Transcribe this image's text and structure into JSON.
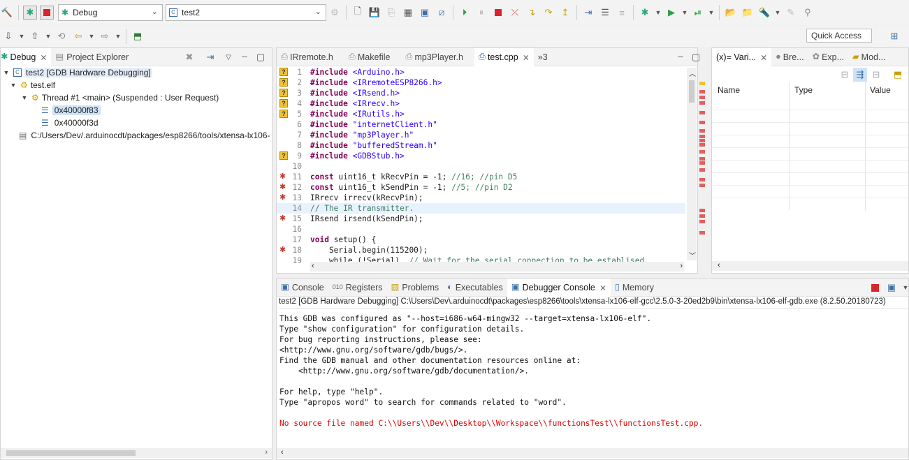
{
  "toolbar": {
    "launch_config": "Debug",
    "launch_target": "test2",
    "quick_access": "Quick Access"
  },
  "debug_view": {
    "tabs": [
      {
        "label": "Debug"
      },
      {
        "label": "Project Explorer"
      }
    ],
    "tree": [
      {
        "label": "test2 [GDB Hardware Debugging]"
      },
      {
        "label": "test.elf"
      },
      {
        "label": "Thread #1 <main> (Suspended : User Request)"
      },
      {
        "label": "0x40000f83"
      },
      {
        "label": "0x40000f3d"
      },
      {
        "label": "C:/Users/Dev/.arduinocdt/packages/esp8266/tools/xtensa-lx106-"
      }
    ]
  },
  "editor": {
    "tabs": [
      {
        "label": "IRremote.h"
      },
      {
        "label": "Makefile"
      },
      {
        "label": "mp3Player.h"
      },
      {
        "label": "test.cpp"
      },
      {
        "label": "»3"
      }
    ],
    "lines": [
      {
        "n": "1",
        "pre": "#include ",
        "arg": "<Arduino.h>",
        "marker": "q"
      },
      {
        "n": "2",
        "pre": "#include ",
        "arg": "<IRremoteESP8266.h>",
        "marker": "q"
      },
      {
        "n": "3",
        "pre": "#include ",
        "arg": "<IRsend.h>",
        "marker": "q"
      },
      {
        "n": "4",
        "pre": "#include ",
        "arg": "<IRrecv.h>",
        "marker": "q"
      },
      {
        "n": "5",
        "pre": "#include ",
        "arg": "<IRutils.h>",
        "marker": "q"
      },
      {
        "n": "6",
        "pre": "#include ",
        "arg": "\"internetClient.h\"",
        "marker": ""
      },
      {
        "n": "7",
        "pre": "#include ",
        "arg": "\"mp3Player.h\"",
        "marker": ""
      },
      {
        "n": "8",
        "pre": "#include ",
        "arg": "\"bufferedStream.h\"",
        "marker": ""
      },
      {
        "n": "9",
        "pre": "#include ",
        "arg": "<GDBStub.h>",
        "marker": "q"
      },
      {
        "n": "10",
        "code": "",
        "marker": ""
      },
      {
        "n": "11",
        "kw": "const",
        "code": " uint16_t kRecvPin = -1; ",
        "cmt": "//16; //pin D5",
        "marker": "bp"
      },
      {
        "n": "12",
        "kw": "const",
        "code": " uint16_t kSendPin = -1; ",
        "cmt": "//5; //pin D2",
        "marker": "bp"
      },
      {
        "n": "13",
        "code": "IRrecv irrecv(kRecvPin);",
        "marker": "bp"
      },
      {
        "n": "14",
        "cmt": "// The IR transmitter.",
        "marker": "",
        "current": true
      },
      {
        "n": "15",
        "code": "IRsend irsend(kSendPin);",
        "marker": "bp"
      },
      {
        "n": "16",
        "code": "",
        "marker": ""
      },
      {
        "n": "17",
        "kw": "void",
        "code": " setup() {",
        "marker": ""
      },
      {
        "n": "18",
        "code": "    Serial.begin(115200);",
        "marker": "bp"
      },
      {
        "n": "19",
        "code": "    while (!Serial)  ",
        "cmt": "// Wait for the serial connection to be establised.",
        "marker": ""
      }
    ]
  },
  "variables_view": {
    "tabs": [
      {
        "label": "(x)= Vari..."
      },
      {
        "label": "Bre..."
      },
      {
        "label": "Exp..."
      },
      {
        "label": "Mod..."
      }
    ],
    "columns": [
      "Name",
      "Type",
      "Value"
    ]
  },
  "console_view": {
    "tabs": [
      {
        "label": "Console"
      },
      {
        "label": "Registers"
      },
      {
        "label": "Problems"
      },
      {
        "label": "Executables"
      },
      {
        "label": "Debugger Console"
      },
      {
        "label": "Memory"
      }
    ],
    "header": "test2 [GDB Hardware Debugging] C:\\Users\\Dev\\.arduinocdt\\packages\\esp8266\\tools\\xtensa-lx106-elf-gcc\\2.5.0-3-20ed2b9\\bin\\xtensa-lx106-elf-gdb.exe (8.2.50.20180723)",
    "lines": [
      {
        "text": "This GDB was configured as \"--host=i686-w64-mingw32 --target=xtensa-lx106-elf\".",
        "error": false
      },
      {
        "text": "Type \"show configuration\" for configuration details.",
        "error": false
      },
      {
        "text": "For bug reporting instructions, please see:",
        "error": false
      },
      {
        "text": "<http://www.gnu.org/software/gdb/bugs/>.",
        "error": false
      },
      {
        "text": "Find the GDB manual and other documentation resources online at:",
        "error": false
      },
      {
        "text": "    <http://www.gnu.org/software/gdb/documentation/>.",
        "error": false
      },
      {
        "text": "",
        "error": false
      },
      {
        "text": "For help, type \"help\".",
        "error": false
      },
      {
        "text": "Type \"apropos word\" to search for commands related to \"word\".",
        "error": false
      },
      {
        "text": "",
        "error": false
      },
      {
        "text": "No source file named C:\\\\Users\\\\Dev\\\\Desktop\\\\Workspace\\\\functionsTest\\\\functionsTest.cpp.",
        "error": true
      }
    ]
  },
  "colors": {
    "accent": "#cfe3f7",
    "error": "#e00000",
    "keyword": "#7f0055",
    "string": "#2a00ff",
    "comment": "#3f7f5f"
  }
}
